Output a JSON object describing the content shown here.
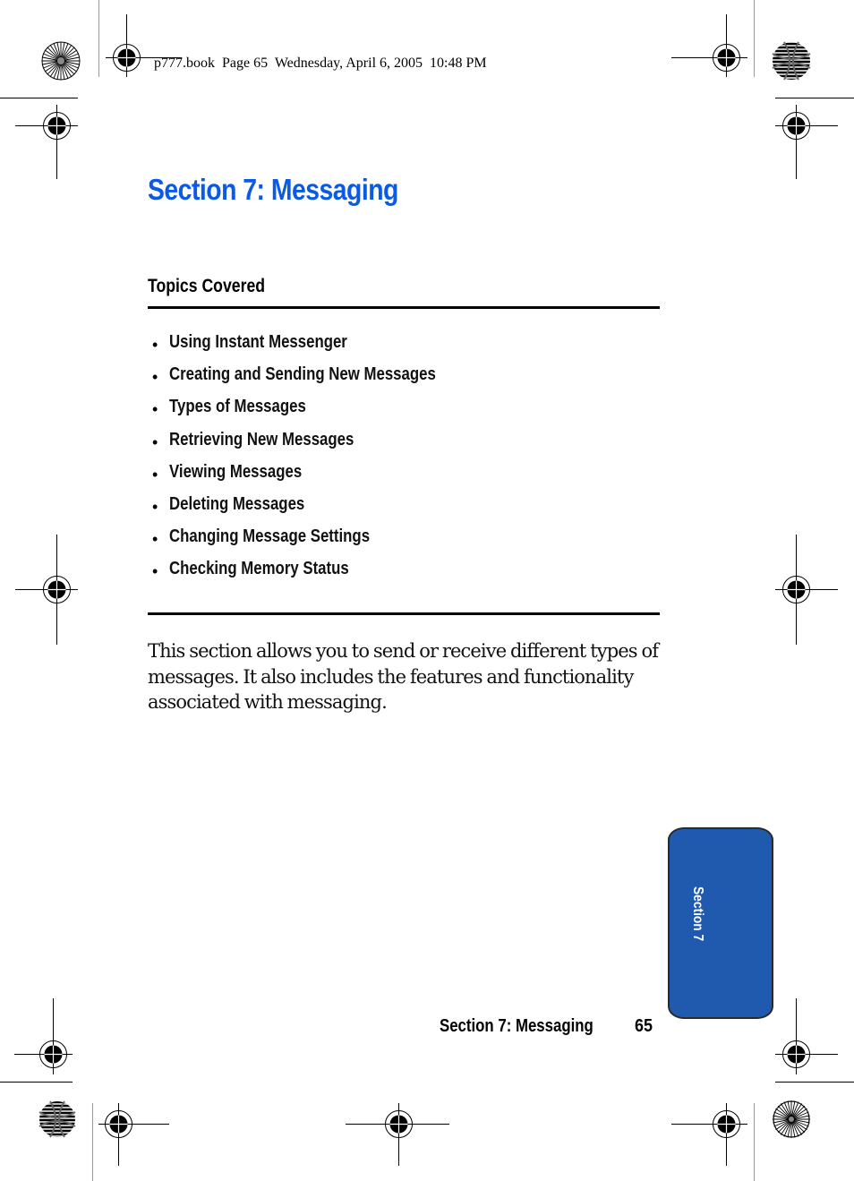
{
  "print_slug": "p777.book  Page 65  Wednesday, April 6, 2005  10:48 PM",
  "page": {
    "title": "Section 7: Messaging",
    "topics_heading": "Topics Covered",
    "topics": [
      "Using Instant Messenger",
      "Creating and Sending New Messages",
      "Types of Messages",
      "Retrieving New Messages",
      "Viewing Messages",
      "Deleting Messages",
      "Changing Message Settings",
      "Checking Memory Status"
    ],
    "bullet_glyph": "•",
    "intro": "This section allows you to send or receive different types of messages. It also includes the features and functionality associated with messaging."
  },
  "side_tab": {
    "label": "Section 7",
    "color": "#1f5aae"
  },
  "footer": {
    "section_title": "Section 7: Messaging",
    "page_number": "65"
  },
  "colors": {
    "title_blue": "#0a5ae6",
    "text": "#000000"
  }
}
